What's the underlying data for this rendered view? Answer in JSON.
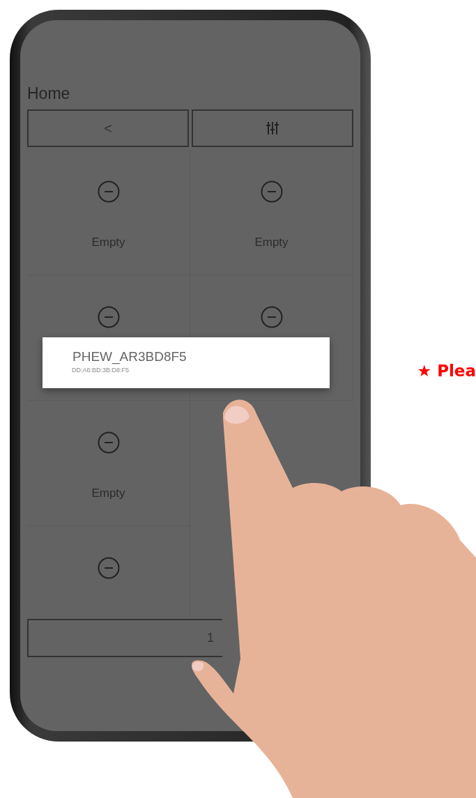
{
  "screen": {
    "title": "Home",
    "toolbar": [
      {
        "kind": "back",
        "label": "<"
      },
      {
        "kind": "equalizer"
      }
    ],
    "slots": [
      {
        "kind": "labeled",
        "label": "Empty"
      },
      {
        "kind": "labeled",
        "label": "Empty"
      },
      {
        "kind": "icon"
      },
      {
        "kind": "icon"
      },
      {
        "kind": "labeled",
        "label": "Empty"
      },
      {
        "kind": "covered"
      },
      {
        "kind": "icon"
      },
      {
        "kind": "covered"
      }
    ],
    "popup": {
      "name": "PHEW_AR3BD8F5",
      "address": "DD:A6:BD:3B:D8:F5"
    },
    "bottom_button": {
      "label": "1"
    }
  },
  "side_note": "★ Plea"
}
